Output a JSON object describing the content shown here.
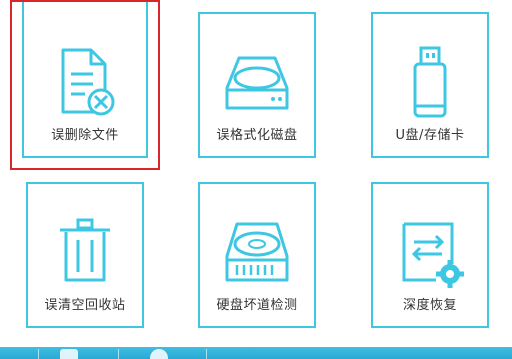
{
  "colors": {
    "accent": "#3ec7e3",
    "selected": "#d9262b",
    "bar": "#29a8d6"
  },
  "selected_tile": "deleted-files",
  "tiles": [
    {
      "label": "误删除文件",
      "icon": "document-delete-icon"
    },
    {
      "label": "误格式化磁盘",
      "icon": "hard-drive-icon"
    },
    {
      "label": "U盘/存储卡",
      "icon": "usb-drive-icon"
    },
    {
      "label": "误清空回收站",
      "icon": "trash-bin-icon"
    },
    {
      "label": "硬盘坏道检测",
      "icon": "bad-sector-drive-icon"
    },
    {
      "label": "深度恢复",
      "icon": "deep-recovery-icon"
    }
  ]
}
